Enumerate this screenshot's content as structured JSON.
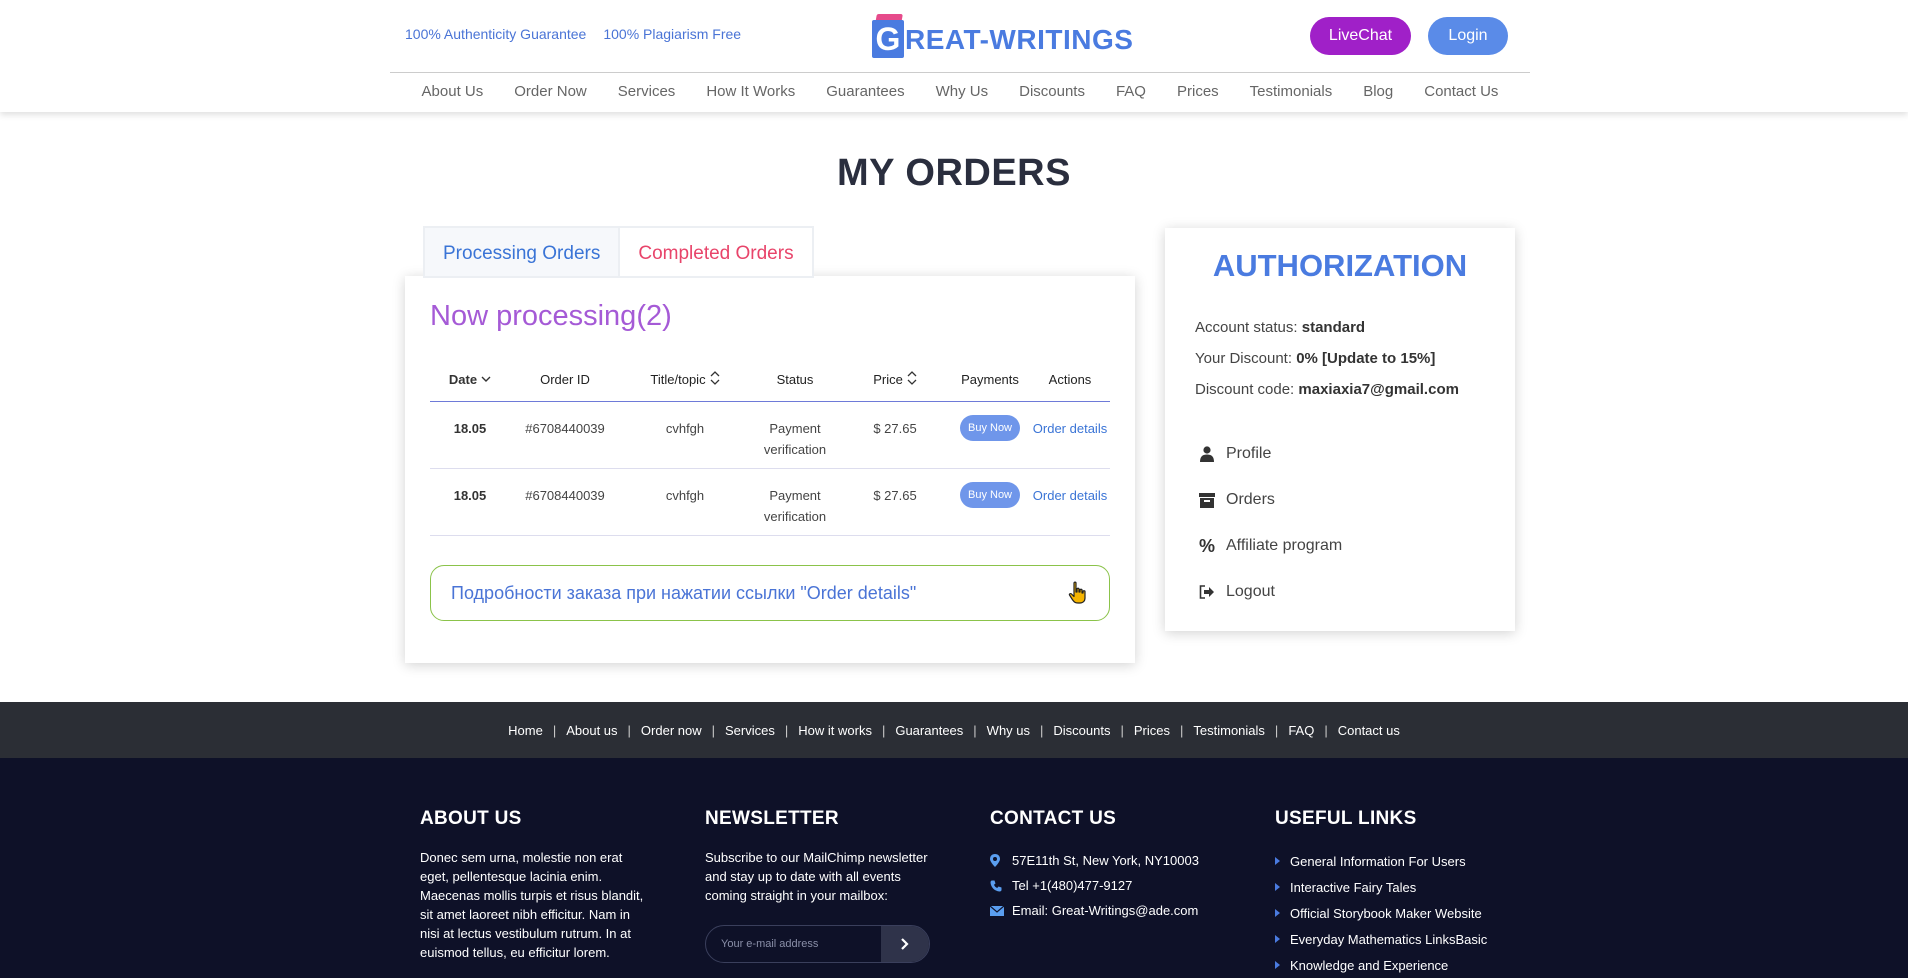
{
  "header": {
    "top_links": [
      "100% Authenticity Guarantee",
      "100% Plagiarism Free"
    ],
    "logo_letter": "G",
    "logo_text": "REAT-WRITINGS",
    "livechat_label": "LiveChat",
    "login_label": "Login",
    "nav": [
      "About Us",
      "Order Now",
      "Services",
      "How It Works",
      "Guarantees",
      "Why Us",
      "Discounts",
      "FAQ",
      "Prices",
      "Testimonials",
      "Blog",
      "Contact Us"
    ]
  },
  "page_title": "MY ORDERS",
  "tabs": {
    "processing": "Processing Orders",
    "completed": "Completed Orders"
  },
  "orders": {
    "heading": "Now processing(2)",
    "columns": {
      "date": "Date",
      "order_id": "Order ID",
      "title": "Title/topic",
      "status": "Status",
      "price": "Price",
      "payments": "Payments",
      "actions": "Actions"
    },
    "rows": [
      {
        "date": "18.05",
        "order_id": "#6708440039",
        "title": "cvhfgh",
        "status": "Payment verification",
        "price": "$ 27.65",
        "pay_button": "Buy Now",
        "action": "Order details"
      },
      {
        "date": "18.05",
        "order_id": "#6708440039",
        "title": "cvhfgh",
        "status": "Payment verification",
        "price": "$ 27.65",
        "pay_button": "Buy Now",
        "action": "Order details"
      }
    ],
    "hint": "Подробности заказа при нажатии ссылки \"Order details\""
  },
  "authorization": {
    "title": "AUTHORIZATION",
    "account_status_label": "Account status:",
    "account_status_value": "standard",
    "discount_label": "Your Discount:",
    "discount_value": "0% [Update to 15%]",
    "code_label": "Discount code:",
    "code_value": "maxiaxia7@gmail.com",
    "menu": {
      "profile": "Profile",
      "orders": "Orders",
      "affiliate": "Affiliate program",
      "logout": "Logout"
    }
  },
  "footer_nav": [
    "Home",
    "About us",
    "Order now",
    "Services",
    "How it works",
    "Guarantees",
    "Why us",
    "Discounts",
    "Prices",
    "Testimonials",
    "FAQ",
    "Contact us"
  ],
  "footer": {
    "about_title": "ABOUT US",
    "about_text": "Donec sem urna, molestie non erat eget, pellentesque lacinia enim. Maecenas mollis turpis et risus blandit, sit amet laoreet nibh efficitur. Nam in nisi at lectus vestibulum rutrum. In at euismod tellus, eu efficitur lorem.",
    "newsletter_title": "NEWSLETTER",
    "newsletter_text": "Subscribe to our MailChimp newsletter and stay up to date with all events coming straight in your mailbox:",
    "newsletter_placeholder": "Your e-mail address",
    "contact_title": "CONTACT US",
    "address": "57E11th St, New York, NY10003",
    "phone": "Tel +1(480)477-9127",
    "email": "Email: Great-Writings@ade.com",
    "links_title": "USEFUL LINKS",
    "links": [
      "General Information For Users",
      "Interactive Fairy Tales",
      "Official Storybook Maker Website",
      "Everyday Mathematics LinksBasic",
      "Knowledge and Experience"
    ]
  },
  "colors": {
    "brand_blue": "#4a7be0",
    "livechat_purple": "#a020c8",
    "heading_purple": "#a55ad6",
    "completed_pink": "#e8446a",
    "hint_border_green": "#8bc34a",
    "footer_bg": "#0e1128",
    "footer_bar_bg": "#2b2e35"
  }
}
